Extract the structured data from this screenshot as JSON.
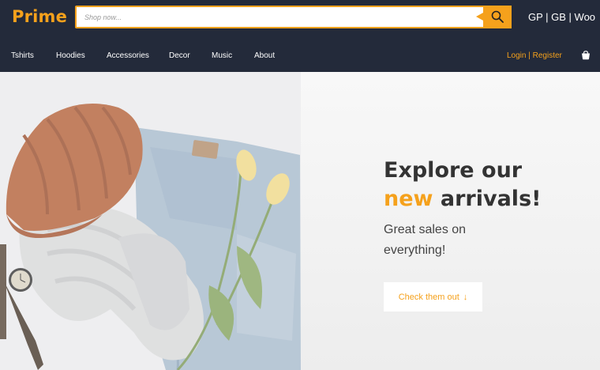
{
  "brand": {
    "logo": "Prime"
  },
  "search": {
    "placeholder": "Shop now..."
  },
  "languages": {
    "text": "GP | GB | Woo"
  },
  "nav": {
    "items": [
      "Tshirts",
      "Hoodies",
      "Accessories",
      "Decor",
      "Music",
      "About"
    ],
    "auth": "Login | Register"
  },
  "hero": {
    "title_line1": "Explore our",
    "title_new": "new",
    "title_rest": " arrivals!",
    "subtitle_line1": "Great sales on",
    "subtitle_line2": "everything!",
    "cta_label": "Check them out"
  },
  "colors": {
    "accent": "#f5a11c",
    "header": "#232a3a"
  }
}
